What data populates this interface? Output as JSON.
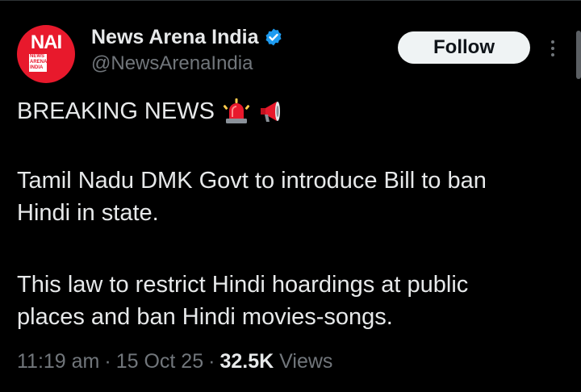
{
  "author": {
    "display_name": "News Arena India",
    "handle": "@NewsArenaIndia",
    "avatar_logo": "NAI",
    "avatar_sub_lines": [
      "NEWS",
      "ARENA",
      "INDIA"
    ],
    "verified": true
  },
  "actions": {
    "follow_label": "Follow",
    "more_icon": "more-vertical-icon"
  },
  "tweet": {
    "headline": "BREAKING NEWS",
    "headline_emojis": [
      "police-light-icon",
      "megaphone-icon"
    ],
    "para2_line1": "Tamil Nadu DMK Govt to introduce Bill to ban",
    "para2_line2": "Hindi in state.",
    "para3_line1": "This law to restrict Hindi hoardings at public",
    "para3_line2": "places and ban Hindi movies-songs."
  },
  "meta": {
    "time": "11:19 am",
    "separator": "·",
    "date": "15 Oct 25",
    "views_count": "32.5K",
    "views_label": "Views"
  },
  "colors": {
    "background": "#000000",
    "text_primary": "#e7e9ea",
    "text_secondary": "#71767b",
    "verified_blue": "#1d9bf0",
    "avatar_red": "#e8192c",
    "button_bg": "#eff3f4"
  }
}
